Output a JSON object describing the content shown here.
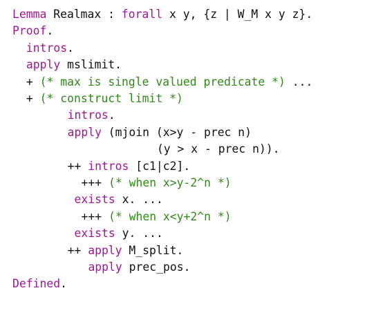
{
  "colors": {
    "keyword": "#a0159a",
    "comment": "#2f8a16",
    "text": "#111111",
    "background": "#ffffff"
  },
  "lines": [
    {
      "indent": 0,
      "tokens": [
        {
          "t": "kw",
          "s": "Lemma"
        },
        {
          "t": "tx",
          "s": " Realmax : "
        },
        {
          "t": "kw",
          "s": "forall"
        },
        {
          "t": "tx",
          "s": " x y, {z | W_M x y z}."
        }
      ]
    },
    {
      "indent": 0,
      "tokens": [
        {
          "t": "kw",
          "s": "Proof"
        },
        {
          "t": "tx",
          "s": "."
        }
      ]
    },
    {
      "indent": 2,
      "tokens": [
        {
          "t": "kw",
          "s": "intros"
        },
        {
          "t": "tx",
          "s": "."
        }
      ]
    },
    {
      "indent": 2,
      "tokens": [
        {
          "t": "kw",
          "s": "apply"
        },
        {
          "t": "tx",
          "s": " mslimit."
        }
      ]
    },
    {
      "indent": 2,
      "tokens": [
        {
          "t": "tx",
          "s": "+ "
        },
        {
          "t": "cm",
          "s": "(* max is single valued predicate *)"
        },
        {
          "t": "tx",
          "s": " ..."
        }
      ]
    },
    {
      "indent": 2,
      "tokens": [
        {
          "t": "tx",
          "s": "+ "
        },
        {
          "t": "cm",
          "s": "(* construct limit *)"
        }
      ]
    },
    {
      "indent": 8,
      "tokens": [
        {
          "t": "kw",
          "s": "intros"
        },
        {
          "t": "tx",
          "s": "."
        }
      ]
    },
    {
      "indent": 8,
      "tokens": [
        {
          "t": "kw",
          "s": "apply"
        },
        {
          "t": "tx",
          "s": " (mjoin (x>y - prec n)"
        }
      ]
    },
    {
      "indent": 21,
      "tokens": [
        {
          "t": "tx",
          "s": "(y > x - prec n))."
        }
      ]
    },
    {
      "indent": 8,
      "tokens": [
        {
          "t": "tx",
          "s": "++ "
        },
        {
          "t": "kw",
          "s": "intros"
        },
        {
          "t": "tx",
          "s": " [c1|c2]."
        }
      ]
    },
    {
      "indent": 10,
      "tokens": [
        {
          "t": "tx",
          "s": "+++ "
        },
        {
          "t": "cm",
          "s": "(* when x>y-2^n *)"
        }
      ]
    },
    {
      "indent": 9,
      "tokens": [
        {
          "t": "kw",
          "s": "exists"
        },
        {
          "t": "tx",
          "s": " x. ..."
        }
      ]
    },
    {
      "indent": 10,
      "tokens": [
        {
          "t": "tx",
          "s": "+++ "
        },
        {
          "t": "cm",
          "s": "(* when x<y+2^n *)"
        }
      ]
    },
    {
      "indent": 9,
      "tokens": [
        {
          "t": "kw",
          "s": "exists"
        },
        {
          "t": "tx",
          "s": " y. ..."
        }
      ]
    },
    {
      "indent": 8,
      "tokens": [
        {
          "t": "tx",
          "s": "++ "
        },
        {
          "t": "kw",
          "s": "apply"
        },
        {
          "t": "tx",
          "s": " M_split."
        }
      ]
    },
    {
      "indent": 11,
      "tokens": [
        {
          "t": "kw",
          "s": "apply"
        },
        {
          "t": "tx",
          "s": " prec_pos."
        }
      ]
    },
    {
      "indent": 0,
      "tokens": [
        {
          "t": "kw",
          "s": "Defined"
        },
        {
          "t": "tx",
          "s": "."
        }
      ]
    }
  ]
}
